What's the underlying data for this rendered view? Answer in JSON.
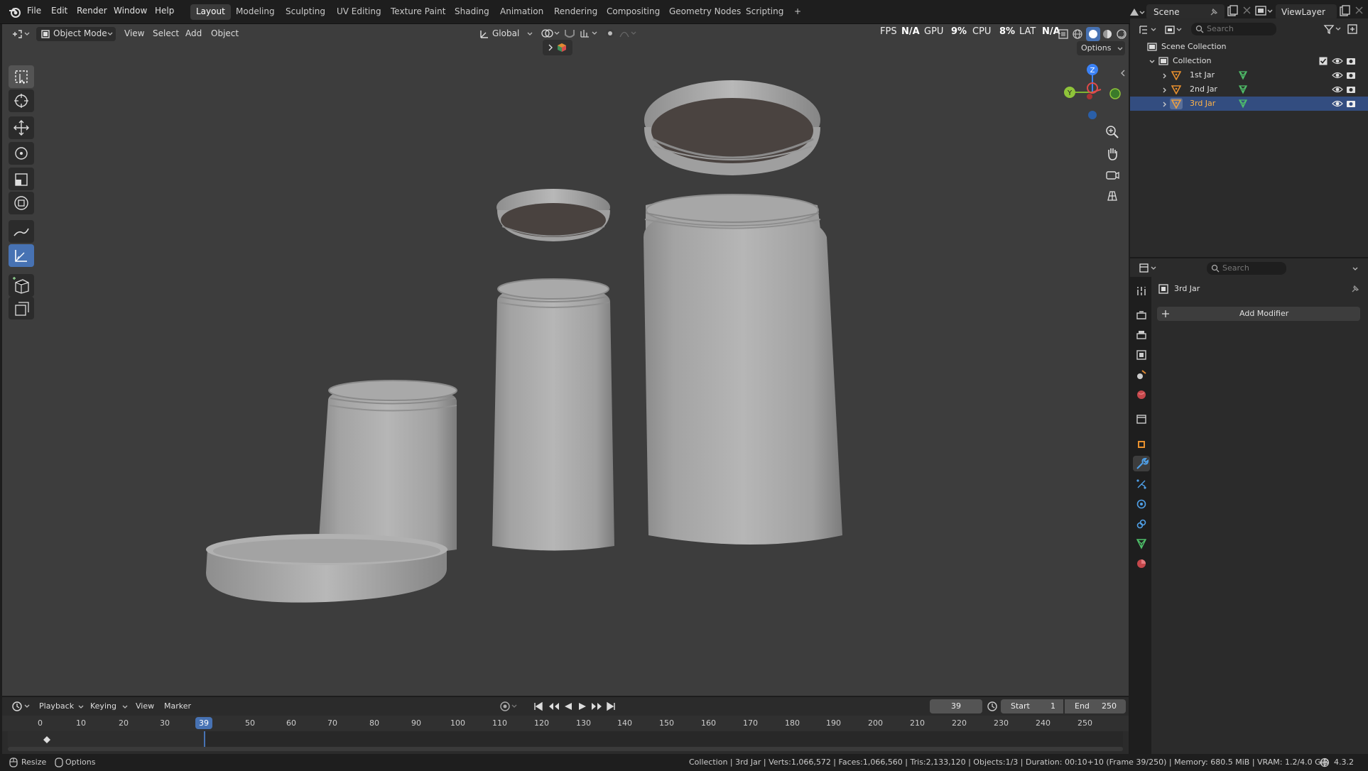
{
  "topbar": {
    "menus": [
      "File",
      "Edit",
      "Render",
      "Window",
      "Help"
    ],
    "workspaces": [
      "Layout",
      "Modeling",
      "Sculpting",
      "UV Editing",
      "Texture Paint",
      "Shading",
      "Animation",
      "Rendering",
      "Compositing",
      "Geometry Nodes",
      "Scripting"
    ],
    "active_workspace": "Layout",
    "add_tab": "+",
    "scene_label": "Scene",
    "viewlayer_label": "ViewLayer"
  },
  "viewport_header": {
    "mode": "Object Mode",
    "menus": [
      "View",
      "Select",
      "Add",
      "Object"
    ],
    "transform_orientation": "Global",
    "stats": {
      "fps_label": "FPS",
      "fps_value": "N/A",
      "gpu_label": "GPU",
      "gpu_value": "9%",
      "cpu_label": "CPU",
      "cpu_value": "8%",
      "lat_label": "LAT",
      "lat_value": "N/A"
    },
    "options_label": "Options"
  },
  "navigation_gizmo": {
    "z": "Z",
    "y": "Y"
  },
  "outliner": {
    "search_placeholder": "Search",
    "scene_collection": "Scene Collection",
    "collection": "Collection",
    "items": [
      {
        "name": "1st Jar",
        "selected": false
      },
      {
        "name": "2nd Jar",
        "selected": false
      },
      {
        "name": "3rd Jar",
        "selected": true
      }
    ]
  },
  "properties": {
    "search_placeholder": "Search",
    "object_name": "3rd Jar",
    "add_modifier_label": "Add Modifier"
  },
  "timeline": {
    "menus": [
      "Playback",
      "Keying",
      "View",
      "Marker"
    ],
    "current_frame": "39",
    "start_label": "Start",
    "start_value": "1",
    "end_label": "End",
    "end_value": "250",
    "ruler_ticks": [
      "0",
      "10",
      "20",
      "30",
      "50",
      "60",
      "70",
      "80",
      "90",
      "100",
      "110",
      "120",
      "130",
      "140",
      "150",
      "160",
      "170",
      "180",
      "190",
      "200",
      "210",
      "220",
      "230",
      "240",
      "250"
    ],
    "playhead_label": "39"
  },
  "statusbar": {
    "left_resize": "Resize",
    "left_options": "Options",
    "info": "Collection | 3rd Jar | Verts:1,066,572 | Faces:1,066,560 | Tris:2,133,120 | Objects:1/3 | Duration: 00:10+10 (Frame 39/250) | Memory: 680.5 MiB | VRAM: 1.2/4.0 GiB",
    "version": "4.3.2"
  },
  "colors": {
    "accent": "#4772b3",
    "selected_row": "#334d80",
    "object_orange": "#e8902e",
    "mesh_green": "#4fbf6a"
  }
}
